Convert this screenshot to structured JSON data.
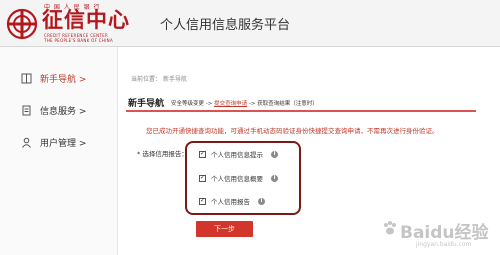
{
  "header": {
    "logo_top": "中 国 人 民 银 行",
    "logo_name": "征信中心",
    "logo_en_line1": "CREDIT REFERENCE CENTER",
    "logo_en_line2": "THE PEOPLE'S BANK OF CHINA",
    "platform_title": "个人信用信息服务平台"
  },
  "sidebar": {
    "items": [
      {
        "label": "新手导航 >",
        "icon": "book-icon",
        "active": true
      },
      {
        "label": "信息服务 >",
        "icon": "document-icon",
        "active": false
      },
      {
        "label": "用户管理 >",
        "icon": "user-icon",
        "active": false
      }
    ]
  },
  "breadcrumb": {
    "prefix": "当前位置：",
    "current": "新手导航"
  },
  "guide": {
    "title": "新手导航",
    "step1": "安全等级变更",
    "step2": "提交查询申请",
    "step3": "获取查询结果（注意",
    "step3_tail": "时）",
    "arrow": "->"
  },
  "notice": "您已成功开通快捷查询功能，可通过手机动态码验证身份快捷提交查询申请，不需再次进行身份验证。",
  "form": {
    "select_label": "* 选择信用报告：",
    "options": [
      {
        "label": "个人信用信息提示",
        "checked": true
      },
      {
        "label": "个人信用信息概要",
        "checked": true
      },
      {
        "label": "个人信用报告",
        "checked": true
      }
    ],
    "next_label": "下一步"
  },
  "colors": {
    "brand_red": "#b5171e",
    "button_red": "#d1352c",
    "highlight_border": "#7a1a14"
  },
  "watermark": {
    "main": "Baidu经验",
    "sub": "jingyan.baidu.com"
  }
}
